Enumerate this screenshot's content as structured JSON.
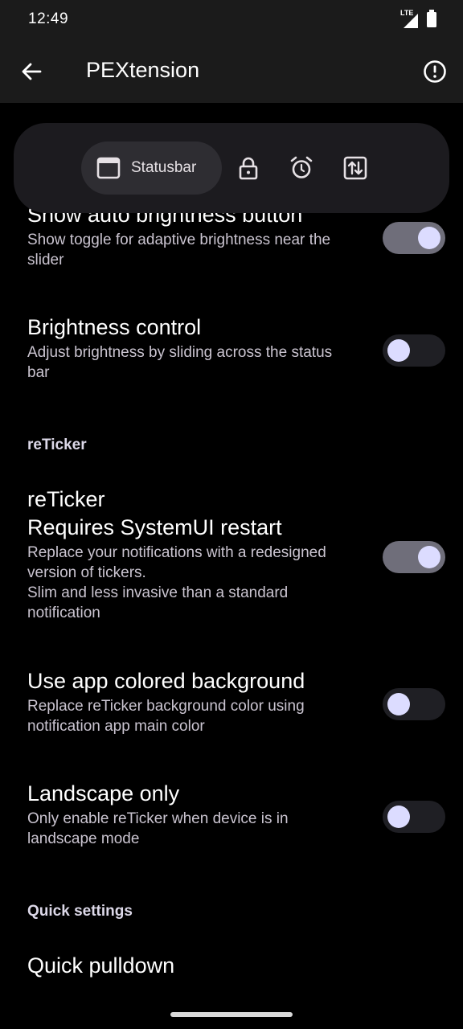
{
  "status": {
    "time": "12:49",
    "network": "LTE"
  },
  "app_bar": {
    "title": "PEXtension"
  },
  "tabs": {
    "active_label": "Statusbar"
  },
  "prefs": [
    {
      "title": "Show auto brightness button",
      "summary": [
        "Show toggle for adaptive brightness near the",
        "slider"
      ],
      "checked": true
    },
    {
      "title": "Brightness control",
      "summary": [
        "Adjust brightness by sliding across the status",
        "bar"
      ],
      "checked": false
    },
    {
      "title": "reTicker",
      "subtitle": "Requires SystemUI restart",
      "summary": [
        "Replace your notifications with a redesigned",
        "version of tickers.",
        "Slim and less invasive than a standard",
        "notification"
      ],
      "checked": true
    },
    {
      "title": "Use app colored background",
      "summary": [
        "Replace reTicker background color using",
        "notification app main color"
      ],
      "checked": false
    },
    {
      "title": "Landscape only",
      "summary": [
        "Only enable reTicker when device is in",
        "landscape mode"
      ],
      "checked": false
    },
    {
      "title": "Quick pulldown"
    }
  ],
  "categories": {
    "reticker": "reTicker",
    "quick_settings": "Quick settings"
  }
}
